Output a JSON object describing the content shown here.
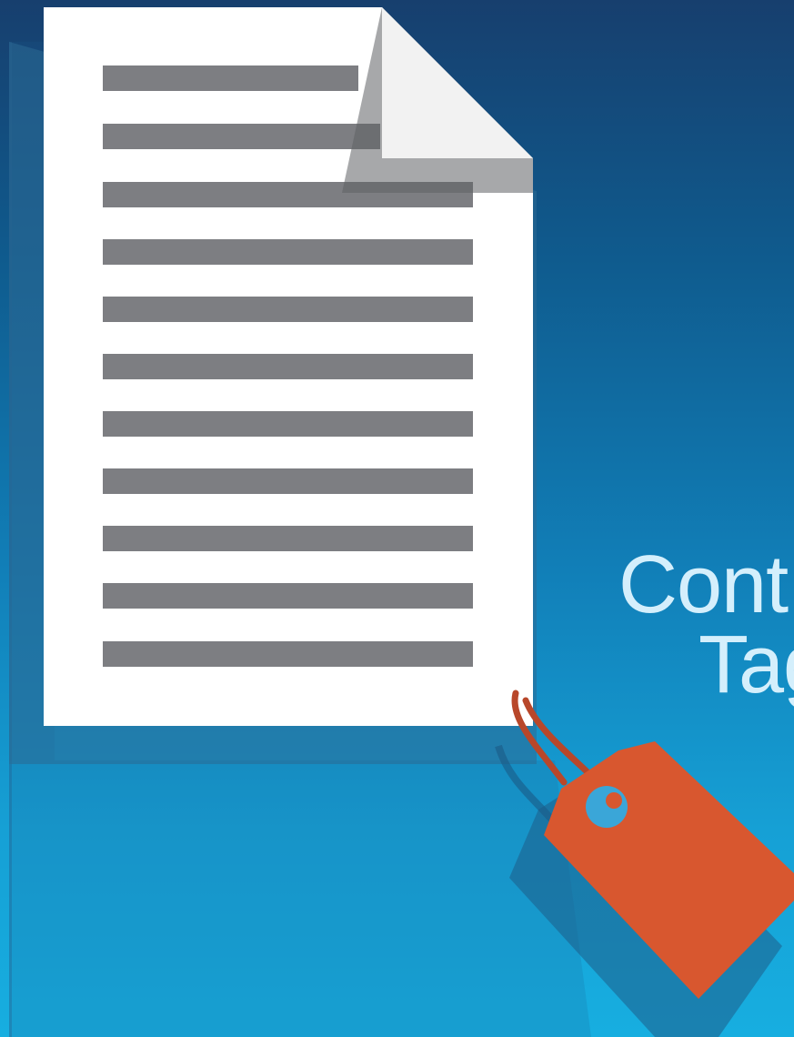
{
  "headline": {
    "line1": "Cont",
    "line2": "Tag"
  },
  "colors": {
    "background_top": "#173f6e",
    "background_bottom": "#17aee0",
    "page": "#ffffff",
    "text_lines": "#7d7e82",
    "tag": "#d8572f",
    "headline": "#d4effc"
  },
  "icons": {
    "document": "document-icon",
    "tag": "price-tag-icon"
  }
}
